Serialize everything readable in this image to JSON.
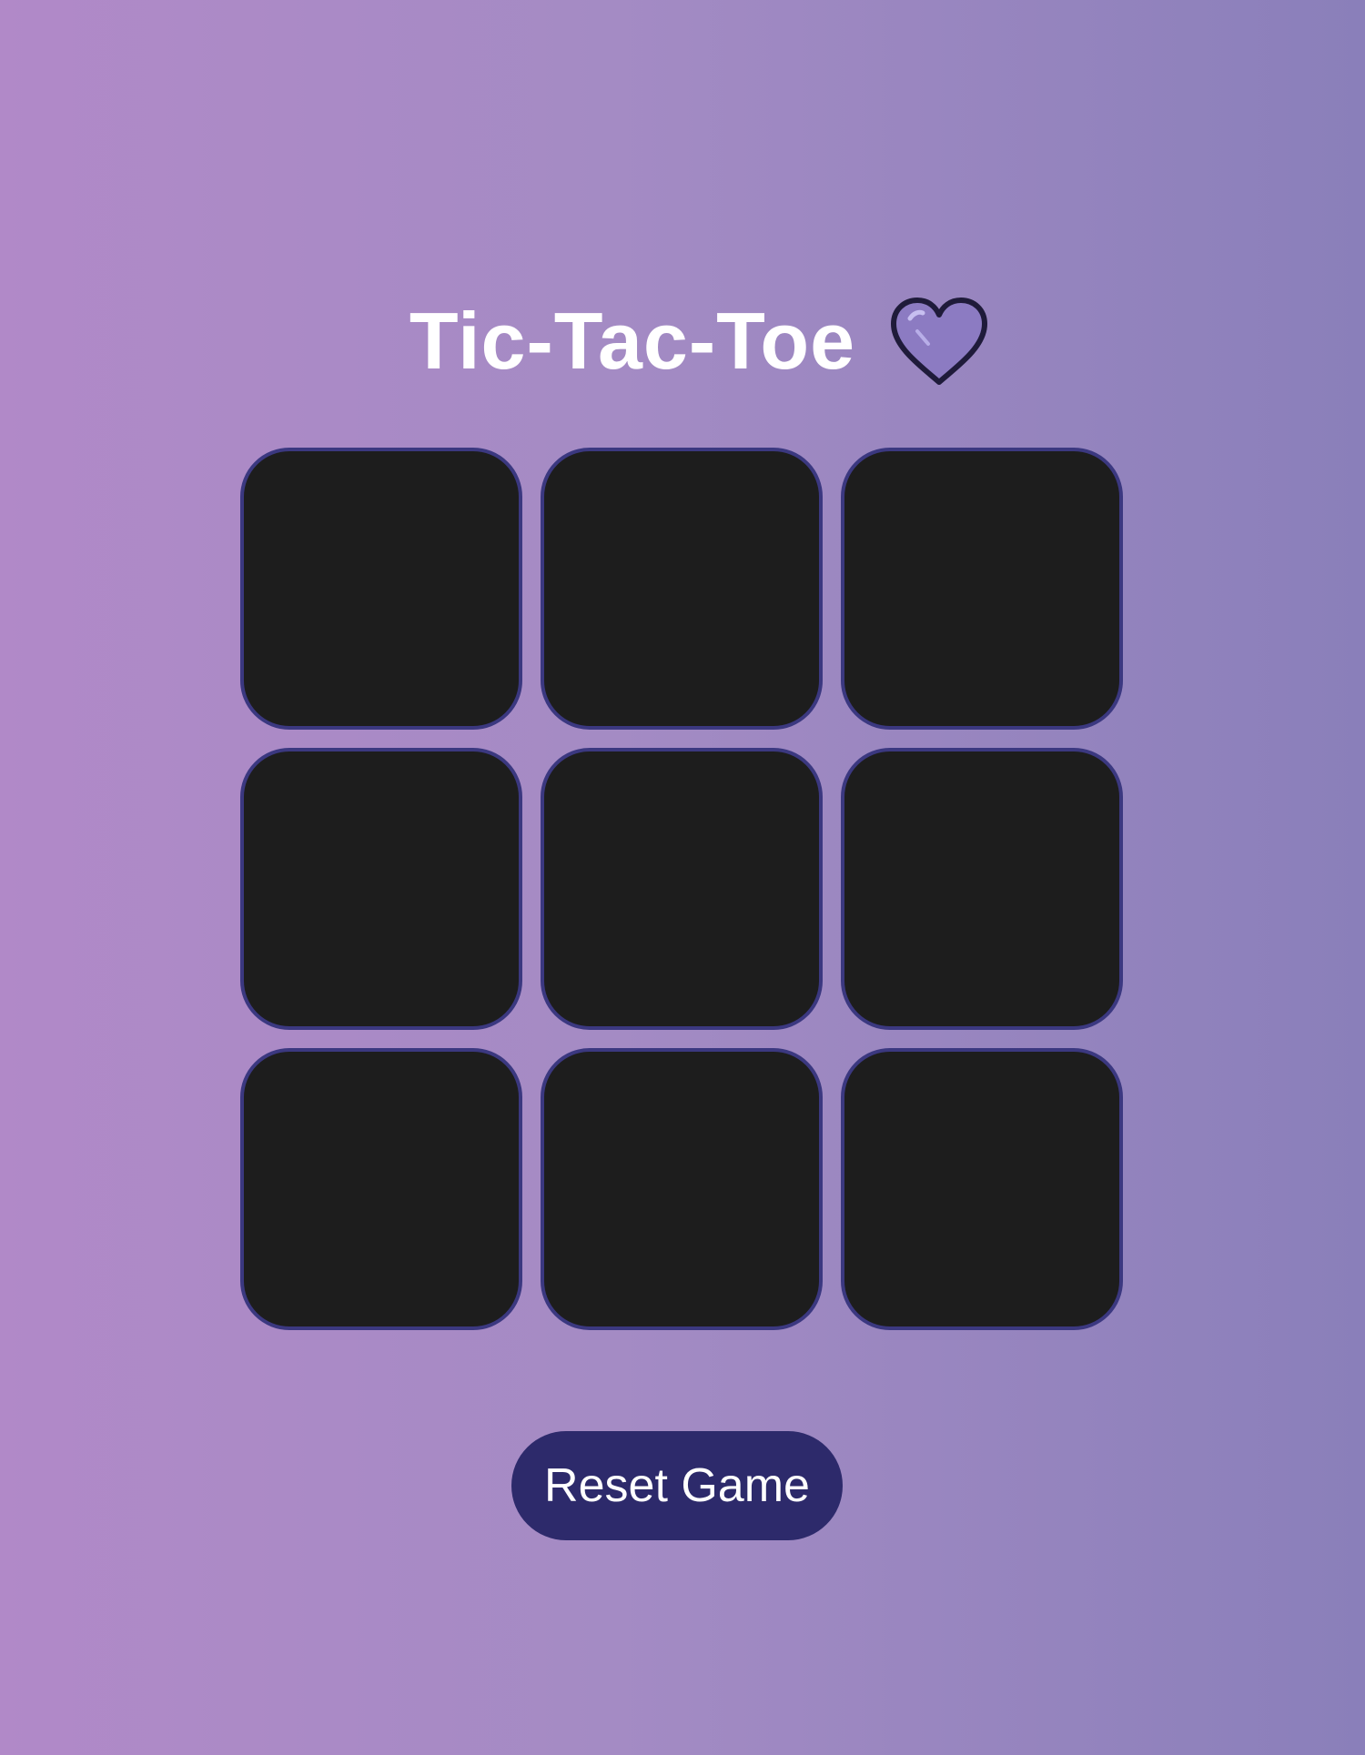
{
  "game": {
    "title": "Tic-Tac-Toe",
    "title_icon": "heart-icon",
    "board": {
      "rows": 3,
      "columns": 3,
      "cells": [
        "",
        "",
        "",
        "",
        "",
        "",
        "",
        "",
        ""
      ]
    },
    "reset_label": "Reset Game"
  },
  "colors": {
    "background_left": "#b189c8",
    "background_right": "#8a7fba",
    "cell_fill": "#1d1d1d",
    "cell_border": "#3b3880",
    "button_fill": "#2d2a6b",
    "heart_fill": "#8c7bc2",
    "text": "#ffffff"
  }
}
